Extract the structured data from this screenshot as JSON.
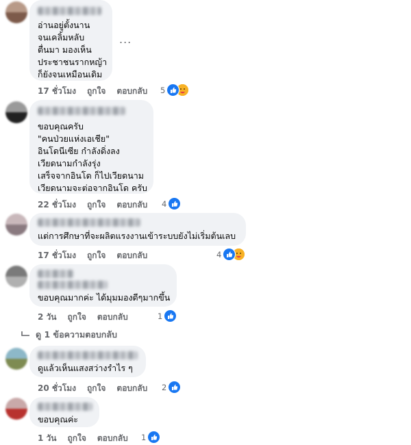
{
  "colors": {
    "bubble_bg": "#f0f2f5",
    "meta_text": "#65676b",
    "like_blue": "#1877f2",
    "care_yellow": "#f7b125"
  },
  "actions": {
    "like": "ถูกใจ",
    "reply": "ตอบกลับ"
  },
  "comments": [
    {
      "lines": [
        "อ่านอยู่ตั้งนาน",
        "จนเคลิ้มหลับ",
        "ตื่นมา มองเห็น",
        "ประชาชนรากหญ้า",
        "ก็ยังจนเหมือนเดิม"
      ],
      "time": "17 ชั่วโมง",
      "reaction_count": "5",
      "reactions": [
        "like-icon",
        "care-icon"
      ],
      "more": "..."
    },
    {
      "lines": [
        "ขอบคุณครับ",
        "\"คนป่วยแห่งเอเชีย\"",
        "อินโดนีเซีย กำลังดิ่งลง",
        "เวียดนามกำลังรุ่ง",
        "เสร็จจากอินโด ก็ไปเวียดนาม",
        "เวียดนามจะต่อจากอินโด ครับ"
      ],
      "time": "22 ชั่วโมง",
      "reaction_count": "4",
      "reactions": [
        "like-icon"
      ]
    },
    {
      "lines": [
        "แต่การศึกษาที่จะผลิตแรงงานเข้าระบบยังไม่เริ่มต้นเลบ"
      ],
      "time": "17 ชั่วโมง",
      "reaction_count": "4",
      "reactions": [
        "like-icon",
        "care-icon"
      ]
    },
    {
      "lines": [
        "ขอบคุณมากค่ะ ได้มุมมองดีๆมากขึ้น"
      ],
      "time": "2 วัน",
      "reaction_count": "1",
      "reactions": [
        "like-icon"
      ],
      "replies_link": "ดู 1 ข้อความตอบกลับ"
    },
    {
      "lines": [
        "ดูแล้วเห็นแสงสว่างรำไร ๆ"
      ],
      "time": "20 ชั่วโมง",
      "reaction_count": "2",
      "reactions": [
        "like-icon"
      ]
    },
    {
      "lines": [
        "ขอบคุณค่ะ"
      ],
      "time": "1 วัน",
      "reaction_count": "1",
      "reactions": [
        "like-icon"
      ]
    }
  ]
}
